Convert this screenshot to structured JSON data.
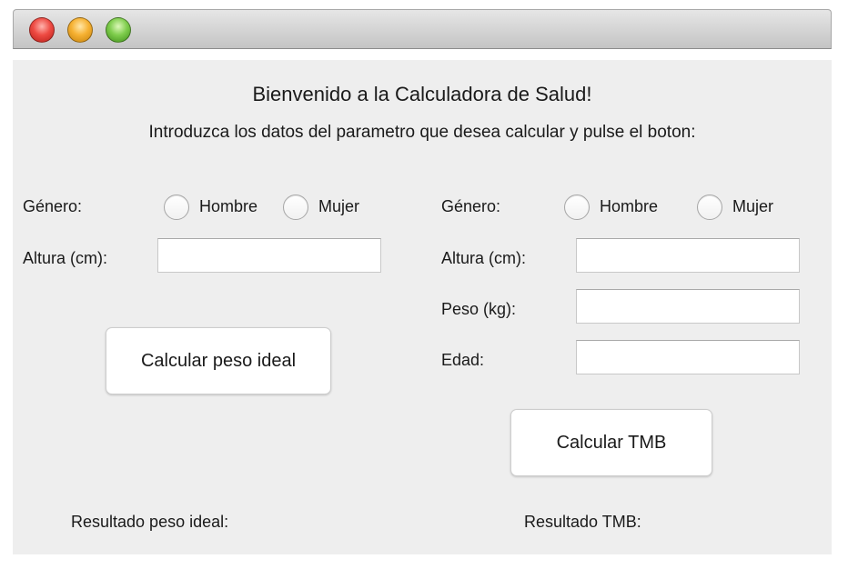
{
  "window": {
    "controls": [
      "close-button",
      "minimize-button",
      "zoom-button"
    ]
  },
  "header": {
    "title": "Bienvenido a la Calculadora de Salud!",
    "subtitle": "Introduzca los datos del parametro que desea calcular y pulse el boton:"
  },
  "ideal_weight": {
    "gender_label": "Género:",
    "option_male": "Hombre",
    "option_female": "Mujer",
    "height_label": "Altura (cm):",
    "height_value": "",
    "button_label": "Calcular peso ideal",
    "result_label": "Resultado peso ideal:"
  },
  "tmb": {
    "gender_label": "Género:",
    "option_male": "Hombre",
    "option_female": "Mujer",
    "height_label": "Altura (cm):",
    "height_value": "",
    "weight_label": "Peso (kg):",
    "weight_value": "",
    "age_label": "Edad:",
    "age_value": "",
    "button_label": "Calcular TMB",
    "result_label": "Resultado TMB:"
  }
}
